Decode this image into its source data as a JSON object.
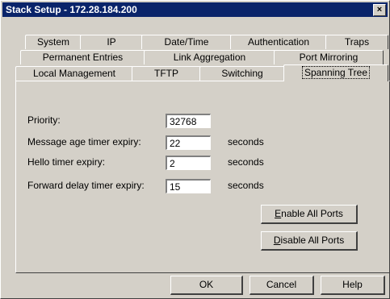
{
  "window": {
    "title": "Stack Setup - 172.28.184.200",
    "close_glyph": "×"
  },
  "tabs": {
    "row1": [
      "System",
      "IP",
      "Date/Time",
      "Authentication",
      "Traps"
    ],
    "row2": [
      "Permanent Entries",
      "Link Aggregation",
      "Port Mirroring"
    ],
    "row3": [
      "Local Management",
      "TFTP",
      "Switching",
      "Spanning Tree"
    ],
    "active": "Spanning Tree"
  },
  "form": {
    "priority_label": "Priority:",
    "priority_value": "32768",
    "max_age_label": "Message age timer expiry:",
    "max_age_value": "22",
    "hello_label": "Hello timer expiry:",
    "hello_value": "2",
    "fwd_delay_label": "Forward delay timer expiry:",
    "fwd_delay_value": "15",
    "unit_seconds": "seconds"
  },
  "buttons": {
    "enable_all_mnemonic": "E",
    "enable_all_rest": "nable All Ports",
    "disable_all_mnemonic": "D",
    "disable_all_rest": "isable All Ports",
    "ok": "OK",
    "cancel": "Cancel",
    "help": "Help"
  }
}
